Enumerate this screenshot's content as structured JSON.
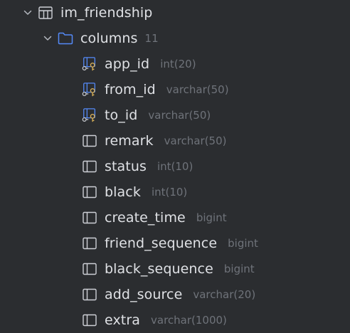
{
  "tree": {
    "table": {
      "name": "im_friendship",
      "icon": "table-icon"
    },
    "columns_folder": {
      "label": "columns",
      "count": "11",
      "icon": "folder-icon",
      "color": "#548af7"
    },
    "columns": [
      {
        "name": "app_id",
        "type": "int(20)",
        "icon": "key-column-icon"
      },
      {
        "name": "from_id",
        "type": "varchar(50)",
        "icon": "key-column-icon"
      },
      {
        "name": "to_id",
        "type": "varchar(50)",
        "icon": "key-column-icon"
      },
      {
        "name": "remark",
        "type": "varchar(50)",
        "icon": "column-icon"
      },
      {
        "name": "status",
        "type": "int(10)",
        "icon": "column-icon"
      },
      {
        "name": "black",
        "type": "int(10)",
        "icon": "column-icon"
      },
      {
        "name": "create_time",
        "type": "bigint",
        "icon": "column-icon"
      },
      {
        "name": "friend_sequence",
        "type": "bigint",
        "icon": "column-icon"
      },
      {
        "name": "black_sequence",
        "type": "bigint",
        "icon": "column-icon"
      },
      {
        "name": "add_source",
        "type": "varchar(20)",
        "icon": "column-icon"
      },
      {
        "name": "extra",
        "type": "varchar(1000)",
        "icon": "column-icon"
      }
    ]
  },
  "colors": {
    "background": "#2b2d30",
    "text": "#dfe1e5",
    "muted": "#6f737a",
    "key_blue": "#548af7",
    "key_gold": "#d6ae58"
  }
}
